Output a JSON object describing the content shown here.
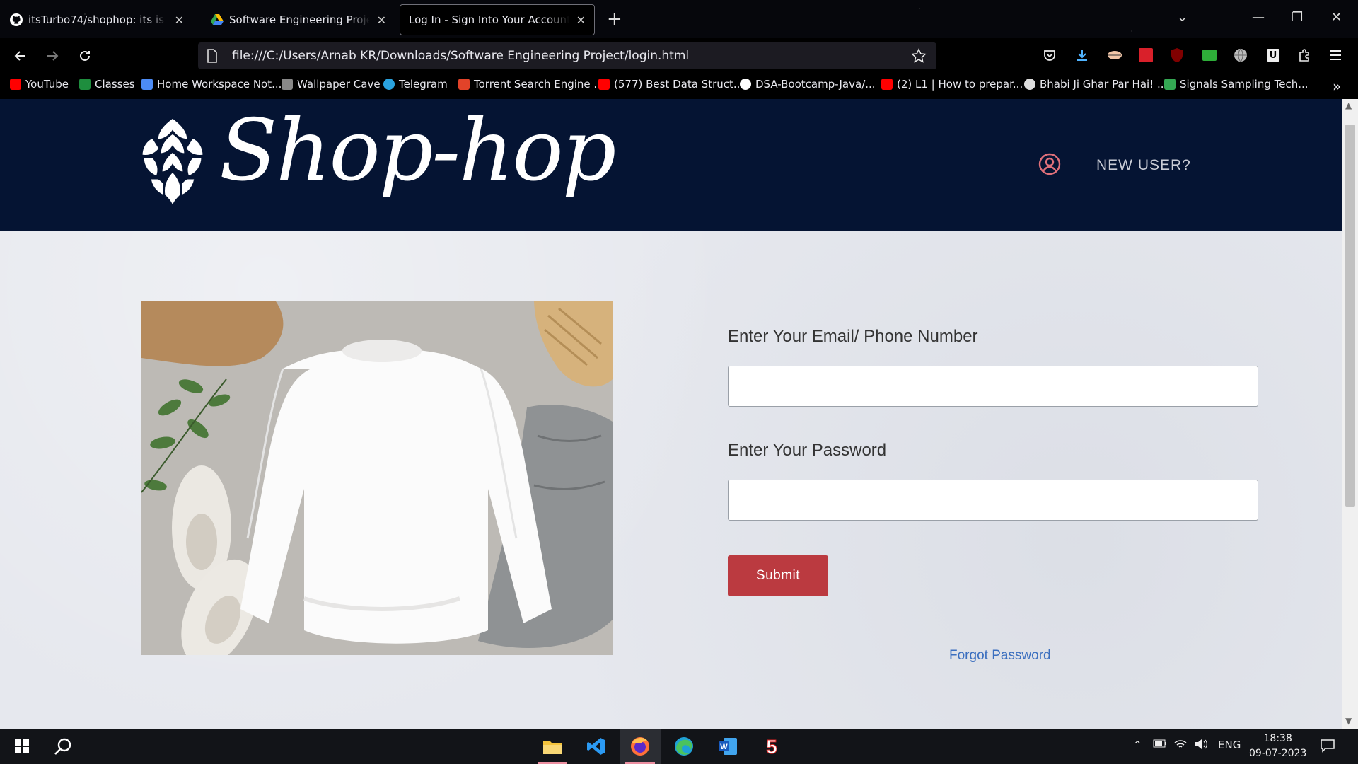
{
  "browser": {
    "tabs": [
      {
        "title": "itsTurbo74/shophop: its is my se",
        "icon": "github-icon"
      },
      {
        "title": "Software Engineering Project -",
        "icon": "google-drive-icon"
      },
      {
        "title": "Log In - Sign Into Your Account",
        "icon": "none",
        "active": true
      }
    ],
    "url": "file:///C:/Users/Arnab KR/Downloads/Software Engineering Project/login.html",
    "bookmarks": [
      {
        "label": "YouTube",
        "icon": "youtube-icon",
        "color": "#ff0000"
      },
      {
        "label": "Classes",
        "icon": "google-classroom-icon",
        "color": "#1e8e3e"
      },
      {
        "label": "Home Workspace Not...",
        "icon": "workspace-icon",
        "color": "#4c8bf5"
      },
      {
        "label": "Wallpaper Cave",
        "icon": "wallpaper-cave-icon",
        "color": "#888888"
      },
      {
        "label": "Telegram",
        "icon": "telegram-icon",
        "color": "#2aa3df"
      },
      {
        "label": "Torrent Search Engine ...",
        "icon": "torrent-icon",
        "color": "#e24329"
      },
      {
        "label": "(577) Best Data Struct...",
        "icon": "youtube-icon",
        "color": "#ff0000"
      },
      {
        "label": "DSA-Bootcamp-Java/...",
        "icon": "github-icon",
        "color": "#ffffff"
      },
      {
        "label": "(2) L1 | How to prepar...",
        "icon": "youtube-icon",
        "color": "#ff0000"
      },
      {
        "label": "Bhabi Ji Ghar Par Hai! ...",
        "icon": "site-icon",
        "color": "#dddddd"
      },
      {
        "label": "Signals Sampling Tech...",
        "icon": "site-icon",
        "color": "#34a853"
      }
    ]
  },
  "site": {
    "logo_text": "Shop-hop",
    "new_user": "NEW USER?",
    "form": {
      "email_label": "Enter Your Email/ Phone Number",
      "email_value": "",
      "password_label": "Enter Your Password",
      "password_value": "",
      "submit_label": "Submit",
      "forgot_label": "Forgot Password"
    }
  },
  "taskbar": {
    "language": "ENG",
    "time": "18:38",
    "date": "09-07-2023"
  },
  "colors": {
    "header_bg": "#051433",
    "submit_bg": "#bb3a40",
    "link": "#3b6fbf",
    "user_icon": "#e0707a"
  }
}
